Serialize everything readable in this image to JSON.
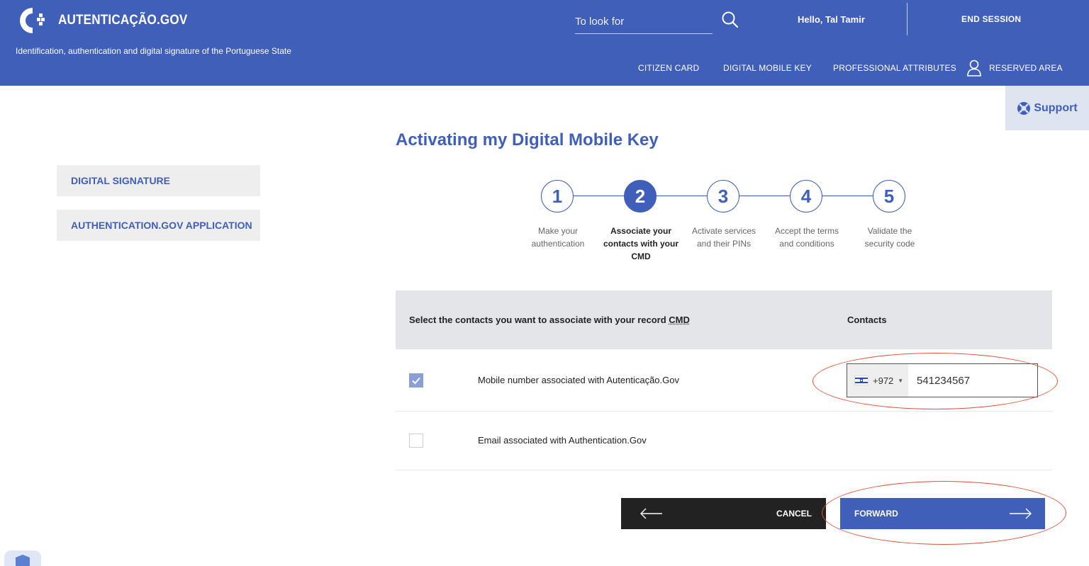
{
  "header": {
    "logo_text": "AUTENTICAÇÃO.GOV",
    "tagline": "Identification, authentication and digital signature of the Portuguese State",
    "search_placeholder": "To look for",
    "greeting": "Hello, Tal Tamir",
    "end_session": "END SESSION",
    "nav": [
      "CITIZEN CARD",
      "DIGITAL MOBILE KEY",
      "PROFESSIONAL ATTRIBUTES",
      "RESERVED AREA"
    ]
  },
  "support": {
    "label": "Support"
  },
  "sidebar": {
    "items": [
      "DIGITAL SIGNATURE",
      "AUTHENTICATION.GOV APPLICATION"
    ]
  },
  "page": {
    "title": "Activating my Digital Mobile Key"
  },
  "stepper": {
    "current": 2,
    "steps": [
      {
        "number": "1",
        "label_lines": [
          "Make your",
          "authentication"
        ]
      },
      {
        "number": "2",
        "label_lines": [
          "Associate your",
          "contacts with your",
          "CMD"
        ]
      },
      {
        "number": "3",
        "label_lines": [
          "Activate services",
          "and their PINs"
        ]
      },
      {
        "number": "4",
        "label_lines": [
          "Accept the terms",
          "and conditions"
        ]
      },
      {
        "number": "5",
        "label_lines": [
          "Validate the",
          "security code"
        ]
      }
    ]
  },
  "table": {
    "header_left_prefix": "Select the contacts you want to associate with your record ",
    "header_left_abbr": "CMD",
    "header_right": "Contacts",
    "rows": [
      {
        "label": "Mobile number associated with Autenticação.Gov",
        "checked": true,
        "dial_code": "+972",
        "phone": "541234567"
      },
      {
        "label": "Email associated with Authentication.Gov",
        "checked": false
      }
    ]
  },
  "buttons": {
    "cancel": "CANCEL",
    "forward": "FORWARD"
  },
  "colors": {
    "brand": "#3f5fb9",
    "annotation": "#e0503a",
    "dark_button": "#222222"
  }
}
